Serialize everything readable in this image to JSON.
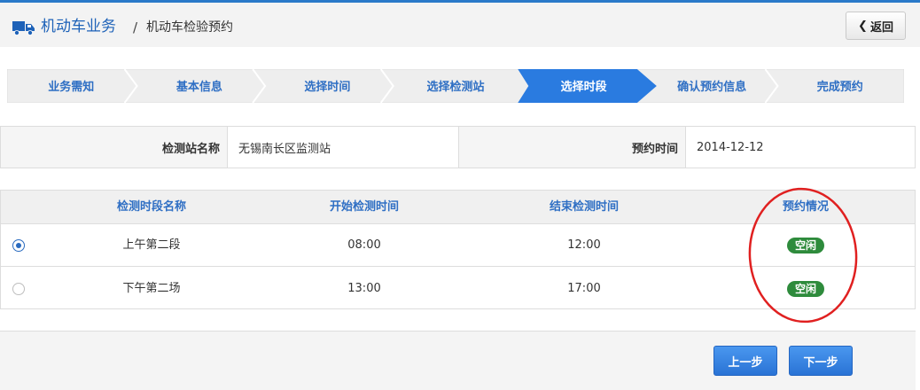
{
  "header": {
    "breadcrumb_main": "机动车业务",
    "breadcrumb_sep": "/",
    "breadcrumb_sub": "机动车检验预约",
    "back_label": "返回"
  },
  "steps": [
    {
      "label": "业务需知",
      "active": false
    },
    {
      "label": "基本信息",
      "active": false
    },
    {
      "label": "选择时间",
      "active": false
    },
    {
      "label": "选择检测站",
      "active": false
    },
    {
      "label": "选择时段",
      "active": true
    },
    {
      "label": "确认预约信息",
      "active": false
    },
    {
      "label": "完成预约",
      "active": false
    }
  ],
  "info": {
    "station_label": "检测站名称",
    "station_value": "无锡南长区监测站",
    "time_label": "预约时间",
    "time_value": "2014-12-12"
  },
  "slots": {
    "headers": [
      "检测时段名称",
      "开始检测时间",
      "结束检测时间",
      "预约情况"
    ],
    "rows": [
      {
        "name": "上午第二段",
        "start": "08:00",
        "end": "12:00",
        "status": "空闲",
        "selected": true
      },
      {
        "name": "下午第二场",
        "start": "13:00",
        "end": "17:00",
        "status": "空闲",
        "selected": false
      }
    ]
  },
  "footer": {
    "prev_label": "上一步",
    "next_label": "下一步"
  },
  "colors": {
    "accent": "#2a79c9",
    "active_step": "#2a7be0",
    "status_free": "#2e8b3c",
    "annotation": "#e02020"
  }
}
